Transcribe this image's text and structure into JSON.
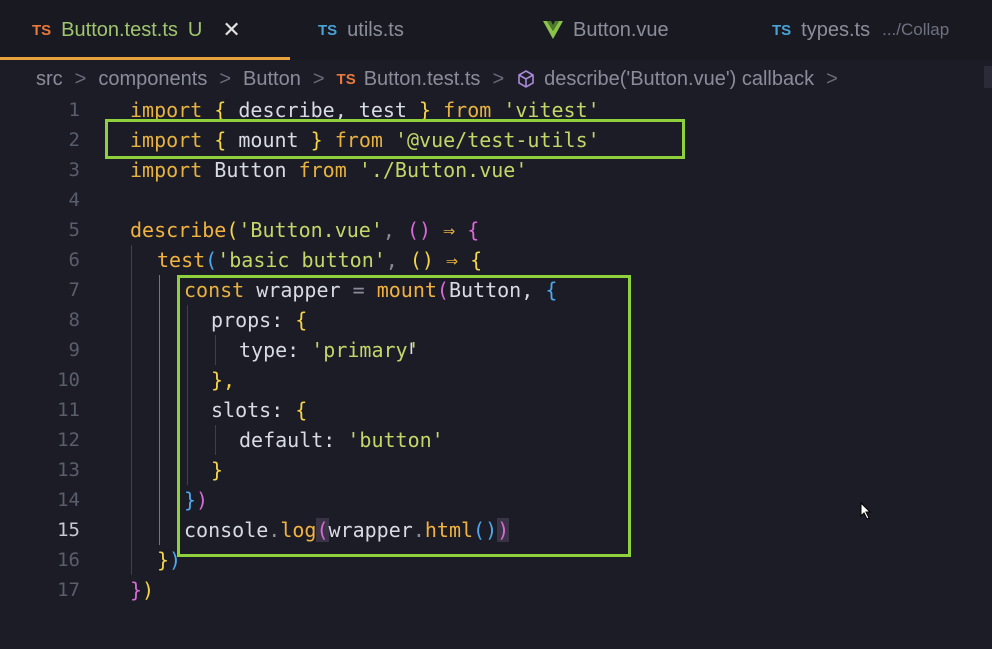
{
  "tabs": [
    {
      "icon": "TS",
      "label": "Button.test.ts",
      "status": "U",
      "active": true
    },
    {
      "icon": "TS",
      "label": "utils.ts"
    },
    {
      "icon": "vue-icon",
      "label": "Button.vue"
    },
    {
      "icon": "TS",
      "label": "types.ts",
      "path": ".../Collap"
    }
  ],
  "breadcrumb": {
    "items": [
      "src",
      "components",
      "Button",
      "Button.test.ts",
      "describe('Button.vue') callback"
    ],
    "file_icon": "TS",
    "separator": ">"
  },
  "editor": {
    "current_line": 15,
    "line_numbers": [
      "1",
      "2",
      "3",
      "4",
      "5",
      "6",
      "7",
      "8",
      "9",
      "10",
      "11",
      "12",
      "13",
      "14",
      "15",
      "16",
      "17"
    ],
    "code": {
      "l1": {
        "import": "import",
        "open": "{",
        "names": "describe, test",
        "close": "}",
        "from": "from",
        "mod": "'vitest'"
      },
      "l2": {
        "import": "import",
        "open": "{",
        "names": "mount",
        "close": "}",
        "from": "from",
        "mod": "'@vue/test-utils'"
      },
      "l3": {
        "import": "import",
        "name": "Button",
        "from": "from",
        "mod": "'./Button.vue'"
      },
      "l5": {
        "fn": "describe",
        "open": "(",
        "arg": "'Button.vue'",
        "comma": ",",
        "parens": "()",
        "arrow": "⇒",
        "brace": "{"
      },
      "l6": {
        "fn": "test",
        "open": "(",
        "arg": "'basic button'",
        "comma": ",",
        "parens": "()",
        "arrow": "⇒",
        "brace": "{"
      },
      "l7": {
        "kw": "const",
        "name": "wrapper",
        "eq": "=",
        "fn": "mount",
        "open": "(",
        "arg": "Button,",
        "brace": "{"
      },
      "l8": {
        "prop": "props:",
        "brace": "{"
      },
      "l9": {
        "prop": "type:",
        "val": "'primary'"
      },
      "l10": {
        "close": "},"
      },
      "l11": {
        "prop": "slots:",
        "brace": "{"
      },
      "l12": {
        "prop": "default:",
        "val": "'button'"
      },
      "l13": {
        "close": "}"
      },
      "l14": {
        "close1": "}",
        "close2": ")"
      },
      "l15": {
        "obj": "console",
        "dot": ".",
        "fn": "log",
        "open": "(",
        "arg": "wrapper",
        "dot2": ".",
        "fn2": "html",
        "parens": "()",
        "close": ")"
      },
      "l16": {
        "close1": "}",
        "close2": ")"
      },
      "l17": {
        "close1": "}",
        "close2": ")"
      }
    }
  },
  "colors": {
    "accent_highlight": "#8fd13d",
    "active_tab_text": "#9fc56e",
    "ts_icon": "#e9793a",
    "keyword": "#e7b23f",
    "string": "#c2d768"
  }
}
